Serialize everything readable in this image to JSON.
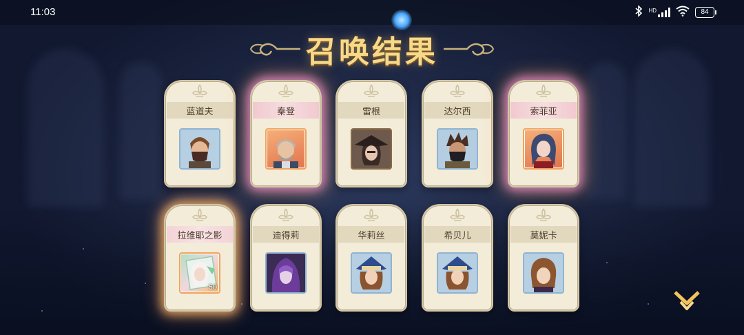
{
  "status_bar": {
    "time": "11:03",
    "signal_label": "HD",
    "battery": "84"
  },
  "title": "召唤结果",
  "colors": {
    "title_gold": "#f7d98a",
    "card_bg": "#f3ecd9",
    "glow_pink": "#f08cdc",
    "glow_gold": "#ffbe6e"
  },
  "cards": [
    {
      "name": "蓝道夫",
      "rarity": "normal",
      "portrait": "blue",
      "icon": "bandana-warrior-portrait"
    },
    {
      "name": "秦登",
      "rarity": "pink",
      "portrait": "orange",
      "icon": "gray-beard-knight-portrait"
    },
    {
      "name": "雷根",
      "rarity": "normal",
      "portrait": "blue",
      "icon": "hooded-hat-rogue-portrait"
    },
    {
      "name": "达尔西",
      "rarity": "normal",
      "portrait": "blue",
      "icon": "masked-fighter-portrait"
    },
    {
      "name": "索菲亚",
      "rarity": "pink",
      "portrait": "orange",
      "icon": "blue-haired-lady-portrait"
    },
    {
      "name": "拉维耶之影",
      "rarity": "gold",
      "portrait": "frag",
      "icon": "white-haired-shard-portrait",
      "count": "50"
    },
    {
      "name": "迪得莉",
      "rarity": "normal",
      "portrait": "blue",
      "icon": "purple-hooded-mage-portrait"
    },
    {
      "name": "华莉丝",
      "rarity": "normal",
      "portrait": "blue",
      "icon": "blue-hat-girl-portrait"
    },
    {
      "name": "希贝儿",
      "rarity": "normal",
      "portrait": "blue",
      "icon": "blue-hat-girl-portrait"
    },
    {
      "name": "莫妮卡",
      "rarity": "normal",
      "portrait": "blue",
      "icon": "brown-haired-girl-portrait"
    }
  ]
}
